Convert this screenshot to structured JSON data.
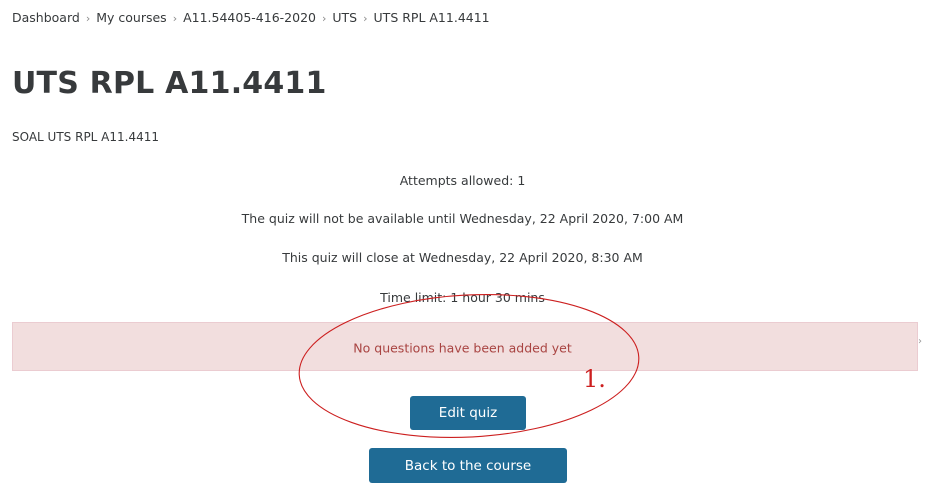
{
  "breadcrumb": {
    "items": [
      "Dashboard",
      "My courses",
      "A11.54405-416-2020",
      "UTS",
      "UTS RPL A11.4411"
    ],
    "separator": "›"
  },
  "page": {
    "title": "UTS RPL A11.4411",
    "intro": "SOAL UTS RPL A11.4411"
  },
  "quiz_info": {
    "attempts": "Attempts allowed: 1",
    "open": "The quiz will not be available until Wednesday, 22 April 2020, 7:00 AM",
    "close": "This quiz will close at Wednesday, 22 April 2020, 8:30 AM",
    "time_limit": "Time limit: 1 hour 30 mins"
  },
  "alert": {
    "message": "No questions have been added yet"
  },
  "buttons": {
    "edit_quiz": "Edit quiz",
    "back_to_course": "Back to the course"
  },
  "annotation": {
    "number": "1."
  },
  "colors": {
    "button_bg": "#1f6b95",
    "alert_bg": "#f2dede",
    "alert_text": "#a94442",
    "annotation": "#cc1f1f"
  }
}
